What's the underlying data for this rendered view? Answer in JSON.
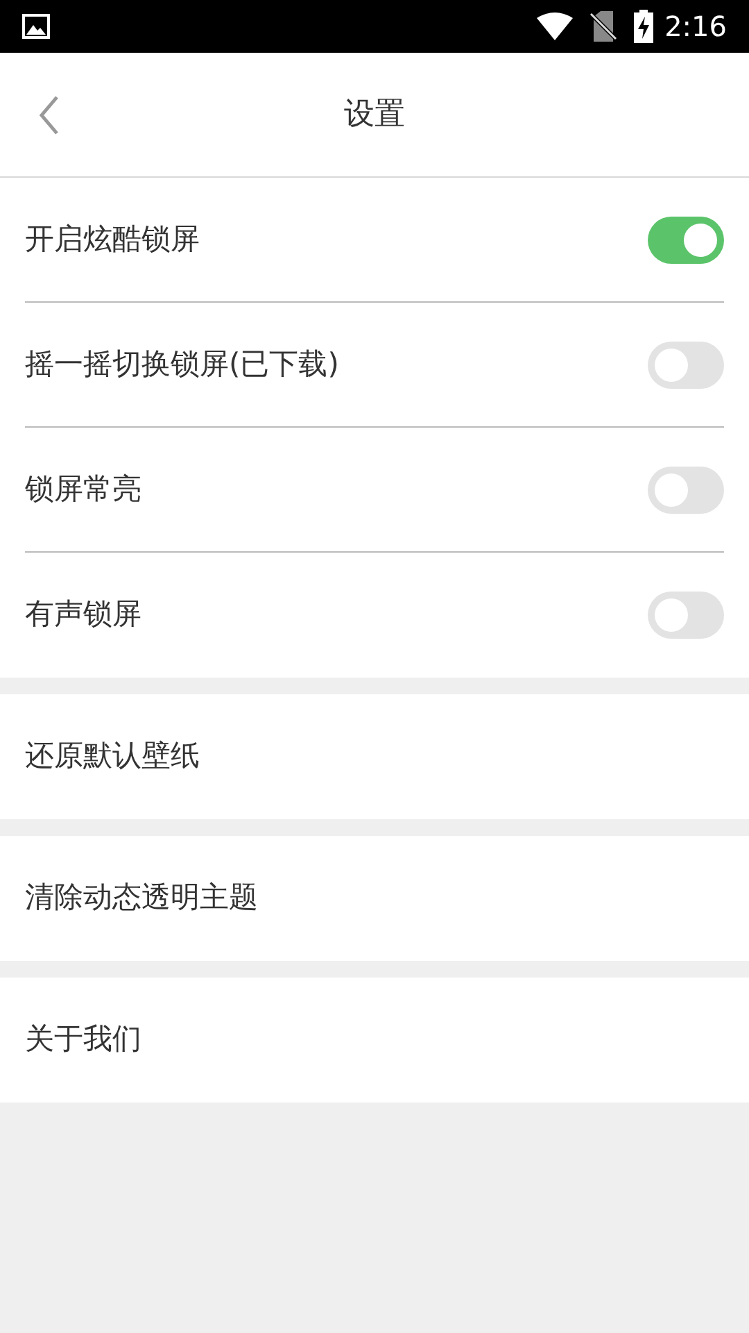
{
  "status_bar": {
    "time": "2:16"
  },
  "header": {
    "title": "设置"
  },
  "groups": [
    {
      "items": [
        {
          "kind": "toggle",
          "label": "开启炫酷锁屏",
          "on": true
        },
        {
          "kind": "toggle",
          "label": "摇一摇切换锁屏(已下载)",
          "on": false
        },
        {
          "kind": "toggle",
          "label": "锁屏常亮",
          "on": false
        },
        {
          "kind": "toggle",
          "label": "有声锁屏",
          "on": false
        }
      ]
    },
    {
      "items": [
        {
          "kind": "action",
          "label": "还原默认壁纸"
        }
      ]
    },
    {
      "items": [
        {
          "kind": "action",
          "label": "清除动态透明主题"
        }
      ]
    },
    {
      "items": [
        {
          "kind": "action",
          "label": "关于我们"
        }
      ]
    }
  ]
}
